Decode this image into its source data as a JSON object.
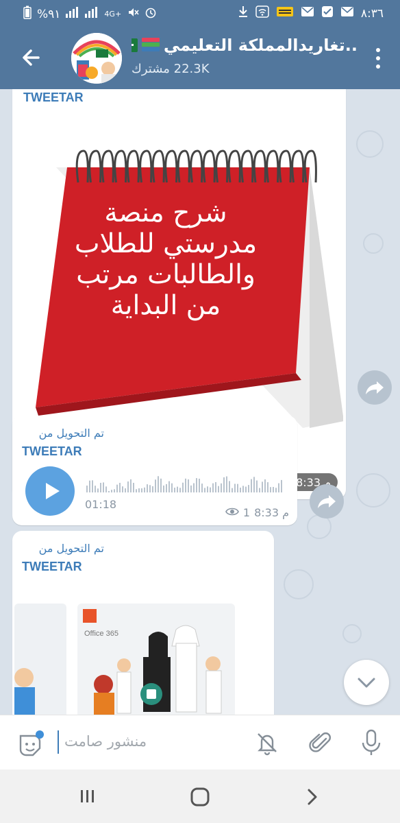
{
  "status_bar": {
    "time": "٨:٣٦",
    "battery": "%٩١",
    "network": "4G+"
  },
  "header": {
    "title": "تغاريدالمملكة التعليمي..",
    "subscribers": "22.3K مشترك"
  },
  "messages": [
    {
      "forwarded_from": "TWEETAR",
      "image_text": [
        "شرح منصة",
        "مدرستي  للطلاب",
        "والطالبات مرتب",
        "من البداية"
      ],
      "time": "8:33 م",
      "views": "1"
    },
    {
      "forwarded_label": "تم التحويل من",
      "forwarded_from": "TWEETAR",
      "duration": "01:18",
      "time": "8:33 م",
      "views": "1"
    },
    {
      "forwarded_label": "تم التحويل من",
      "forwarded_from": "TWEETAR",
      "preview_text": "Office 365"
    }
  ],
  "composer": {
    "placeholder": "منشور صامت"
  },
  "colors": {
    "header": "#52779d",
    "accent": "#3d7cb8",
    "calendar_red": "#d1202a",
    "play": "#5ca2e0"
  }
}
